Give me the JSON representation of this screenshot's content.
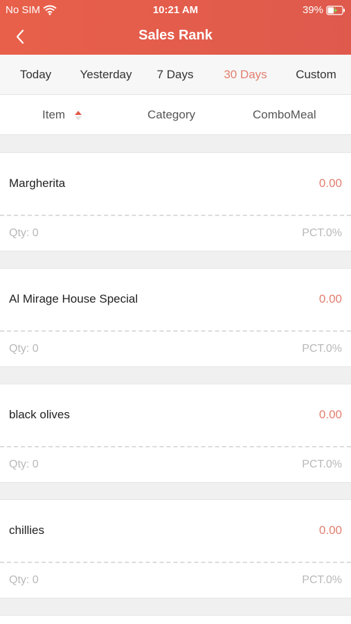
{
  "status": {
    "carrier": "No SIM",
    "time": "10:21 AM",
    "battery": "39%"
  },
  "header": {
    "title": "Sales Rank",
    "back_icon": "chevron-left-icon"
  },
  "tabs": [
    {
      "label": "Today"
    },
    {
      "label": "Yesterday"
    },
    {
      "label": "7 Days"
    },
    {
      "label": "30 Days"
    },
    {
      "label": "Custom"
    }
  ],
  "active_tab": "30 Days",
  "columns": [
    {
      "label": "Item"
    },
    {
      "label": "Category"
    },
    {
      "label": "ComboMeal"
    }
  ],
  "items": [
    {
      "name": "Margherita",
      "amount": "0.00",
      "qty": "Qty: 0",
      "pct": "PCT.0%"
    },
    {
      "name": "Al Mirage House Special",
      "amount": "0.00",
      "qty": "Qty: 0",
      "pct": "PCT.0%"
    },
    {
      "name": "black olives",
      "amount": "0.00",
      "qty": "Qty: 0",
      "pct": "PCT.0%"
    },
    {
      "name": "chillies",
      "amount": "0.00",
      "qty": "Qty: 0",
      "pct": "PCT.0%"
    }
  ],
  "colors": {
    "header": "#e35d4b",
    "accent": "#e27e6e",
    "muted": "#b8b8b8"
  }
}
